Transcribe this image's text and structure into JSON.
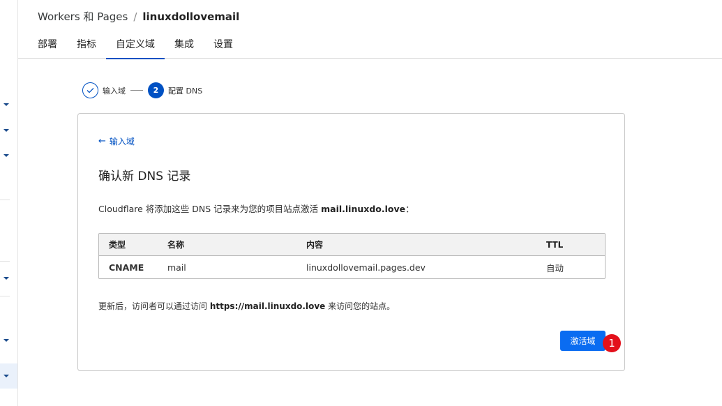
{
  "breadcrumb": {
    "parent": "Workers 和 Pages",
    "separator": "/",
    "current": "linuxdollovemail"
  },
  "tabs": [
    {
      "label": "部署"
    },
    {
      "label": "指标"
    },
    {
      "label": "自定义域",
      "active": true
    },
    {
      "label": "集成"
    },
    {
      "label": "设置"
    }
  ],
  "stepper": {
    "step1_label": "输入域",
    "step2_number": "2",
    "step2_label": "配置 DNS"
  },
  "card": {
    "back_label": "输入域",
    "title": "确认新 DNS 记录",
    "desc_prefix": "Cloudflare 将添加这些 DNS 记录来为您的项目站点激活 ",
    "desc_domain": "mail.linuxdo.love",
    "desc_suffix": "：",
    "table": {
      "headers": {
        "type": "类型",
        "name": "名称",
        "content": "内容",
        "ttl": "TTL"
      },
      "row": {
        "type": "CNAME",
        "name": "mail",
        "content": "linuxdollovemail.pages.dev",
        "ttl": "自动"
      }
    },
    "note_prefix": "更新后，访问者可以通过访问 ",
    "note_url": "https://mail.linuxdo.love",
    "note_suffix": " 来访问您的站点。",
    "activate_label": "激活域"
  },
  "marker": {
    "label": "1",
    "color": "#e3101b"
  },
  "colors": {
    "accent": "#0051c3",
    "button": "#0a6cf1"
  }
}
